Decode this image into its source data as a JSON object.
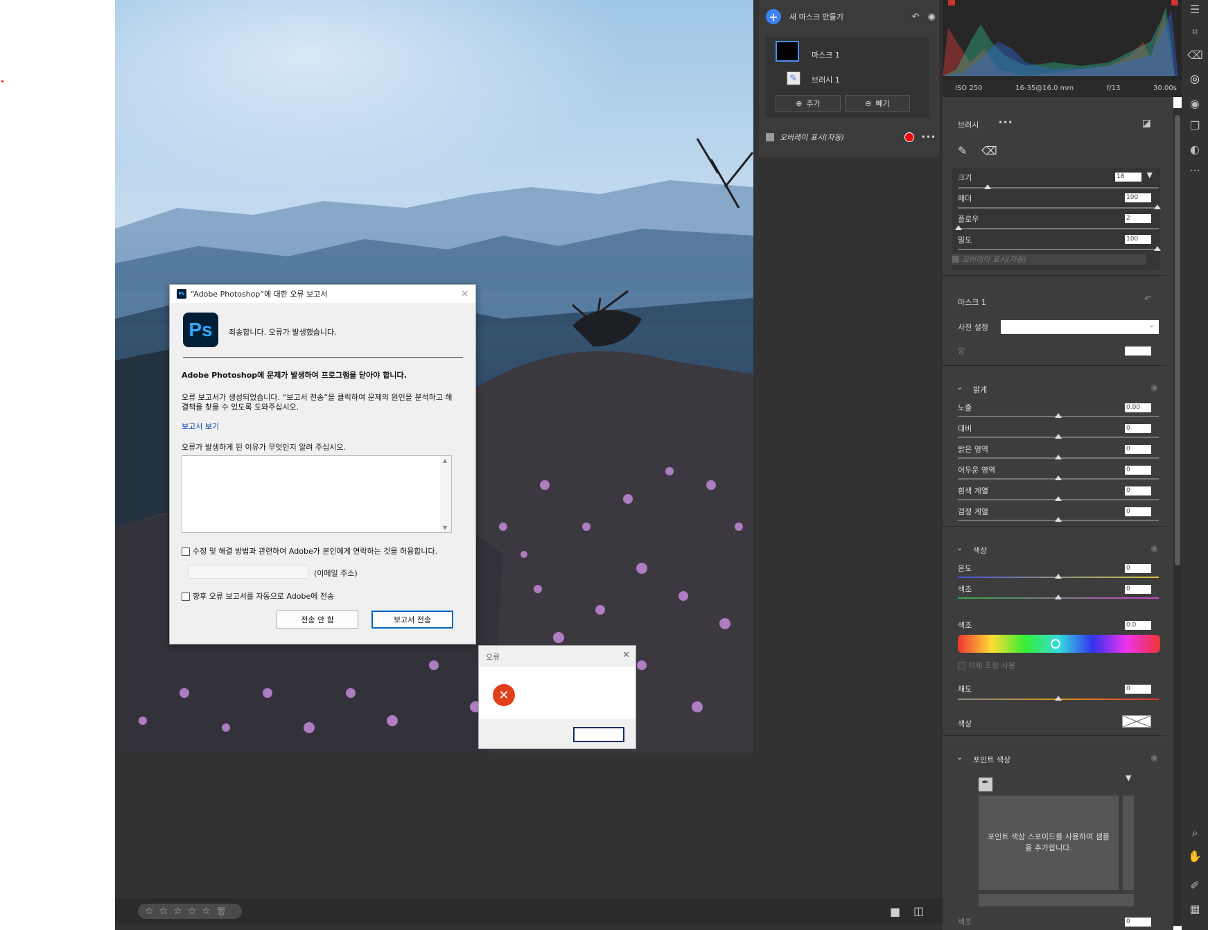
{
  "mask_panel": {
    "new_mask_label": "새 마스크 만들기",
    "mask_name": "마스크 1",
    "brush_name": "브러시 1",
    "add_label": "추가",
    "subtract_label": "빼기",
    "overlay_label": "오버레이 표시(자동)"
  },
  "histogram": {
    "iso": "ISO 250",
    "lens": "16-35@16.0 mm",
    "aperture": "f/13",
    "shutter": "30.00s"
  },
  "brush_section": {
    "title": "브러시",
    "size_label": "크기",
    "size_value": "18",
    "feather_label": "페더",
    "feather_value": "100",
    "flow_label": "플로우",
    "flow_value": "2",
    "density_label": "밀도",
    "density_value": "100",
    "overlay_label": "오버레이 표시(자동)"
  },
  "mask_section": {
    "title": "마스크 1",
    "preset_label": "사전 설정",
    "amount_label": "양"
  },
  "light_section": {
    "title": "밝게",
    "sliders": [
      {
        "label": "노출",
        "value": "0.00"
      },
      {
        "label": "대비",
        "value": "0"
      },
      {
        "label": "밝은 영역",
        "value": "0"
      },
      {
        "label": "어두운 영역",
        "value": "0"
      },
      {
        "label": "흰색 계열",
        "value": "0"
      },
      {
        "label": "검정 계열",
        "value": "0"
      }
    ]
  },
  "color_section": {
    "title": "색상",
    "temp_label": "온도",
    "temp_value": "0",
    "tint_label": "색조",
    "tint_value": "0",
    "hue_label": "색조",
    "hue_value": "0.0",
    "fine_adjust_label": "미세 조정 사용",
    "saturation_label": "채도",
    "saturation_value": "0",
    "color_label": "색상"
  },
  "point_color_section": {
    "title": "포인트 색상",
    "hint": "포인트 색상 스포이드를 사용하여 샘플을 추가합니다.",
    "bottom_label": "색조",
    "bottom_value": "0"
  },
  "report_dialog": {
    "title": "“Adobe Photoshop”에 대한 오류 보고서",
    "ps_logo": "Ps",
    "headline": "죄송합니다. 오류가 발생했습니다.",
    "message": "Adobe Photoshop에 문제가 발생하여 프로그램을 닫아야 합니다.",
    "detail": "오류 보고서가 생성되었습니다. “보고서 전송”을 클릭하여 문제의 원인을 분석하고 해결책을 찾을 수 있도록 도와주십시오.",
    "view_report_link": "보고서 보기",
    "reason_prompt": "오류가 발생하게 된 이유가 무엇인지 알려 주십시오.",
    "contact_checkbox": "수정 및 해결 방법과 관련하여 Adobe가 본인에게 연락하는 것을 허용합니다.",
    "email_label": "(이메일 주소)",
    "auto_send_checkbox": "향후 오류 보고서를 자동으로 Adobe에 전송",
    "dont_send": "전송 안 함",
    "send_report": "보고서 전송"
  },
  "error_dialog": {
    "title": "오류"
  }
}
